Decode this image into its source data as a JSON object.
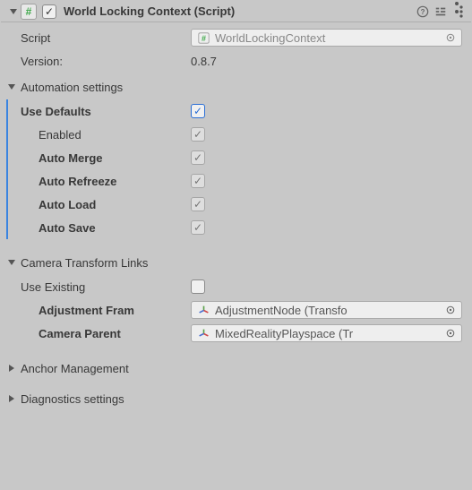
{
  "header": {
    "title": "World Locking Context (Script)",
    "enabled": true
  },
  "script": {
    "label": "Script",
    "value": "WorldLockingContext"
  },
  "version": {
    "label": "Version:",
    "value": "0.8.7"
  },
  "automation": {
    "title": "Automation settings",
    "use_defaults": {
      "label": "Use Defaults",
      "checked": true
    },
    "enabled": {
      "label": "Enabled",
      "checked": true
    },
    "auto_merge": {
      "label": "Auto Merge",
      "checked": true
    },
    "auto_refreeze": {
      "label": "Auto Refreeze",
      "checked": true
    },
    "auto_load": {
      "label": "Auto Load",
      "checked": true
    },
    "auto_save": {
      "label": "Auto Save",
      "checked": true
    }
  },
  "camera_links": {
    "title": "Camera Transform Links",
    "use_existing": {
      "label": "Use Existing",
      "checked": false
    },
    "adjustment": {
      "label": "Adjustment Fram",
      "value": "AdjustmentNode (Transfo"
    },
    "camera_parent": {
      "label": "Camera Parent",
      "value": "MixedRealityPlayspace (Tr"
    }
  },
  "anchor_mgmt": {
    "title": "Anchor Management"
  },
  "diagnostics": {
    "title": "Diagnostics settings"
  }
}
